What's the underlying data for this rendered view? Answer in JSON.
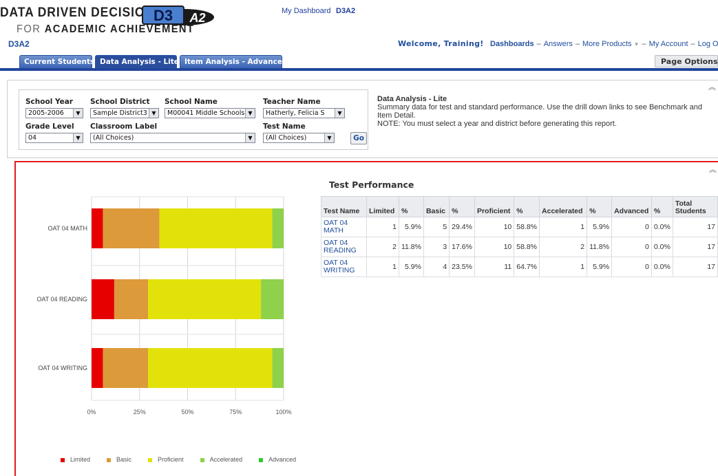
{
  "header": {
    "logo_line1": "DATA DRIVEN DECISIONS",
    "logo_line2_prefix": "FOR",
    "logo_line2_rest": "ACADEMIC ACHIEVEMENT",
    "badge_text": "D3A2",
    "my_dashboard": "My Dashboard",
    "top_app": "D3A2",
    "app_name": "D3A2",
    "welcome": "Welcome, Training!",
    "nav": {
      "dashboards": "Dashboards",
      "answers": "Answers",
      "more_products": "More Products",
      "my_account": "My Account",
      "log_out": "Log Out"
    }
  },
  "tabs": [
    {
      "label": "Current Students"
    },
    {
      "label": "Data Analysis - Lite"
    },
    {
      "label": "Item Analysis - Advanced"
    }
  ],
  "page_options": "Page Options",
  "filters": {
    "school_year": {
      "label": "School Year",
      "value": "2005-2006"
    },
    "school_district": {
      "label": "School District",
      "value": "Sample District3"
    },
    "school_name": {
      "label": "School Name",
      "value": "M00041 Middle Schools"
    },
    "teacher_name": {
      "label": "Teacher Name",
      "value": "Hatherly, Felicia S"
    },
    "grade_level": {
      "label": "Grade Level",
      "value": "04"
    },
    "classroom_label": {
      "label": "Classroom Label",
      "value": "(All Choices)"
    },
    "test_name": {
      "label": "Test Name",
      "value": "(All Choices)"
    },
    "go": "Go"
  },
  "description": {
    "title": "Data Analysis - Lite",
    "line1": "Summary data for test and standard performance. Use the drill down links to see Benchmark and Item Detail.",
    "line2": "NOTE: You must select a year and district before generating this report."
  },
  "report": {
    "title": "Test Performance",
    "columns": [
      "Test Name",
      "Limited",
      "%",
      "Basic",
      "%",
      "Proficient",
      "%",
      "Accelerated",
      "%",
      "Advanced",
      "%",
      "Total Students"
    ],
    "rows": [
      {
        "name": "OAT 04 MATH",
        "limited": "1",
        "limited_pct": "5.9%",
        "basic": "5",
        "basic_pct": "29.4%",
        "proficient": "10",
        "proficient_pct": "58.8%",
        "accelerated": "1",
        "accelerated_pct": "5.9%",
        "advanced": "0",
        "advanced_pct": "0.0%",
        "total": "17"
      },
      {
        "name": "OAT 04 READING",
        "limited": "2",
        "limited_pct": "11.8%",
        "basic": "3",
        "basic_pct": "17.6%",
        "proficient": "10",
        "proficient_pct": "58.8%",
        "accelerated": "2",
        "accelerated_pct": "11.8%",
        "advanced": "0",
        "advanced_pct": "0.0%",
        "total": "17"
      },
      {
        "name": "OAT 04 WRITING",
        "limited": "1",
        "limited_pct": "5.9%",
        "basic": "4",
        "basic_pct": "23.5%",
        "proficient": "11",
        "proficient_pct": "64.7%",
        "accelerated": "1",
        "accelerated_pct": "5.9%",
        "advanced": "0",
        "advanced_pct": "0.0%",
        "total": "17"
      }
    ]
  },
  "chart_data": {
    "type": "bar",
    "orientation": "horizontal",
    "stacked": "percent",
    "categories": [
      "OAT 04 MATH",
      "OAT 04 READING",
      "OAT 04 WRITING"
    ],
    "series": [
      {
        "name": "Limited",
        "color": "#e60000",
        "values": [
          5.9,
          11.8,
          5.9
        ]
      },
      {
        "name": "Basic",
        "color": "#dc9a3a",
        "values": [
          29.4,
          17.6,
          23.5
        ]
      },
      {
        "name": "Proficient",
        "color": "#e2e20a",
        "values": [
          58.8,
          58.8,
          64.7
        ]
      },
      {
        "name": "Accelerated",
        "color": "#8fd14a",
        "values": [
          5.9,
          11.8,
          5.9
        ]
      },
      {
        "name": "Advanced",
        "color": "#2ecc2e",
        "values": [
          0,
          0,
          0
        ]
      }
    ],
    "x_ticks": [
      "0%",
      "25%",
      "50%",
      "75%",
      "100%"
    ],
    "xlim": [
      0,
      100
    ],
    "grid": true,
    "legend_position": "bottom"
  }
}
